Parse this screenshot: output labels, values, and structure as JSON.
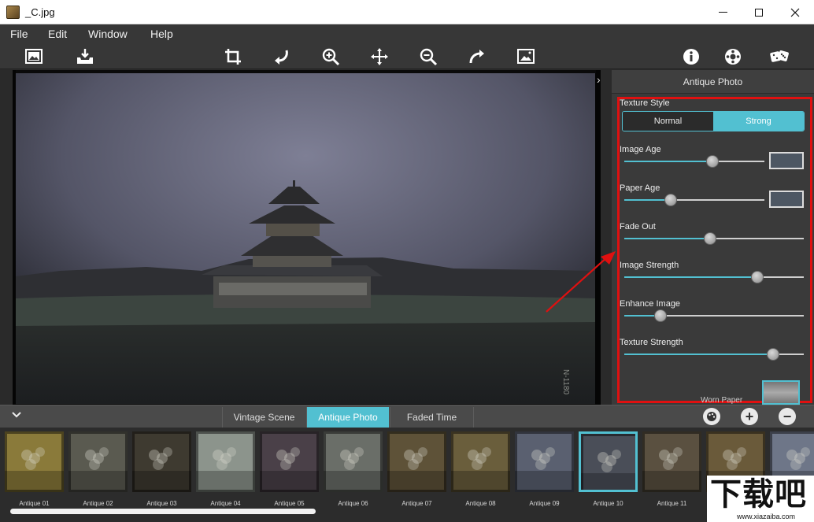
{
  "window": {
    "title": "_C.jpg",
    "controls": [
      "minimize",
      "maximize",
      "close"
    ]
  },
  "menu": [
    "File",
    "Edit",
    "Window",
    "Help"
  ],
  "toolbar": {
    "left": [
      "open-image-icon",
      "save-icon"
    ],
    "center": [
      "crop-icon",
      "undo-icon",
      "zoom-in-icon",
      "move-icon",
      "zoom-out-icon",
      "redo-icon",
      "fit-image-icon"
    ],
    "right": [
      "info-icon",
      "settings-icon",
      "random-icon"
    ]
  },
  "panel": {
    "title": "Antique Photo",
    "texture_style": {
      "label": "Texture Style",
      "options": [
        "Normal",
        "Strong"
      ],
      "selected": "Strong"
    },
    "sliders": [
      {
        "label": "Image Age",
        "value": 0.63,
        "has_swatch": true
      },
      {
        "label": "Paper Age",
        "value": 0.33,
        "has_swatch": true
      },
      {
        "label": "Fade Out",
        "value": 0.48,
        "has_swatch": false
      },
      {
        "label": "Image Strength",
        "value": 0.74,
        "has_swatch": false
      },
      {
        "label": "Enhance Image",
        "value": 0.2,
        "has_swatch": false
      },
      {
        "label": "Texture Strength",
        "value": 0.83,
        "has_swatch": false
      }
    ],
    "swatch_color": "#4d5763",
    "texture_label": "Worn Paper"
  },
  "tabs": {
    "items": [
      "Vintage Scene",
      "Antique Photo",
      "Faded Time"
    ],
    "active": "Antique Photo"
  },
  "presets": [
    {
      "label": "Antique 01",
      "tint": "#8a7a3a"
    },
    {
      "label": "Antique 02",
      "tint": "#5a5a50"
    },
    {
      "label": "Antique 03",
      "tint": "#3e3a30"
    },
    {
      "label": "Antique 04",
      "tint": "#8c948c"
    },
    {
      "label": "Antique 05",
      "tint": "#4a4048"
    },
    {
      "label": "Antique 06",
      "tint": "#6a6e68"
    },
    {
      "label": "Antique 07",
      "tint": "#5e5238"
    },
    {
      "label": "Antique 08",
      "tint": "#6a5e3c"
    },
    {
      "label": "Antique 09",
      "tint": "#5a6070"
    },
    {
      "label": "Antique 10",
      "tint": "#4a4e58",
      "selected": true
    },
    {
      "label": "Antique 11",
      "tint": "#5a5040"
    },
    {
      "label": "",
      "tint": "#6a5a3a"
    },
    {
      "label": "",
      "tint": "#6e7688"
    }
  ],
  "accent": "#52c0d1",
  "annotation_color": "#e01010",
  "watermark": {
    "text": "下载吧",
    "url_text": "www.xiazaiba.com"
  }
}
